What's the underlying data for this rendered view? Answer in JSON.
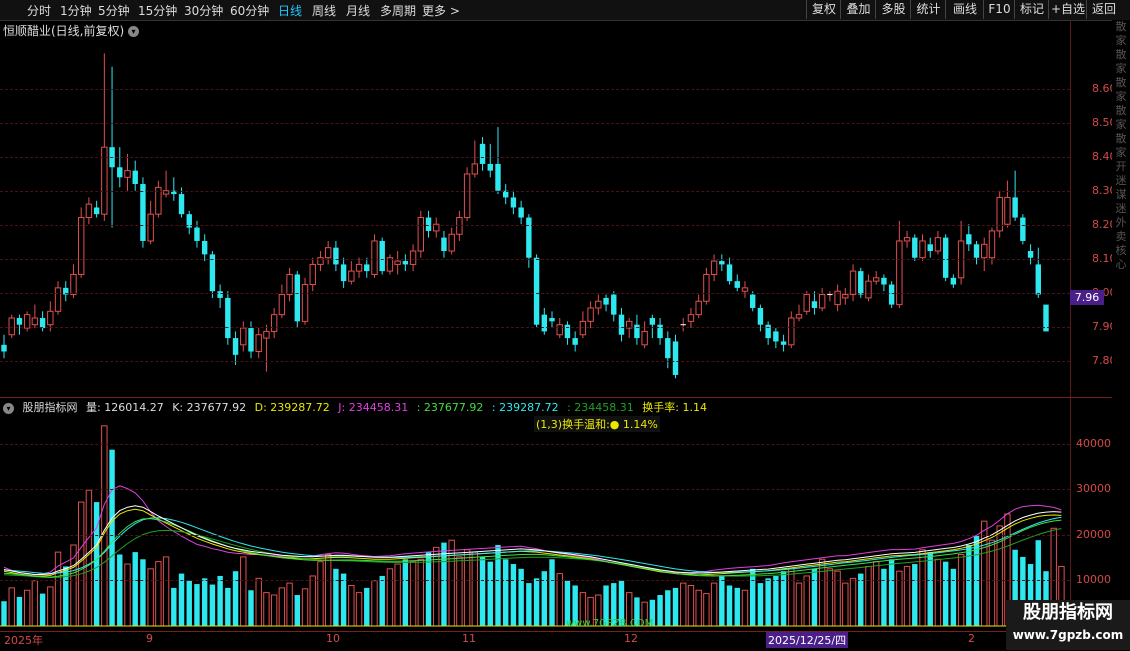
{
  "toolbar": {
    "periods": [
      "分时",
      "1分钟",
      "5分钟",
      "15分钟",
      "30分钟",
      "60分钟",
      "日线",
      "周线",
      "月线",
      "多周期",
      "更多 >"
    ],
    "active_period": "日线",
    "actions": [
      "复权",
      "叠加",
      "多股",
      "统计",
      "画线",
      "F10",
      "标记",
      "+自选",
      "返回"
    ]
  },
  "main": {
    "title": "恒顺醋业(日线,前复权)",
    "y_ticks": [
      "8.60",
      "8.50",
      "8.40",
      "8.30",
      "8.20",
      "8.10",
      "8.00",
      "7.90",
      "7.80"
    ],
    "last_price": "7.96"
  },
  "indicator": {
    "name": "股朋指标网",
    "vol": "量: 126014.27",
    "k": "K: 237677.92",
    "d": "D: 239287.72",
    "j": "J: 234458.31",
    "v1": ": 237677.92",
    "v2": ": 239287.72",
    "v3": ": 234458.31",
    "turnover": "换手率: 1.14",
    "note": "(1,3)换手温和:● 1.14%",
    "y_ticks": [
      "40000",
      "30000",
      "20000",
      "10000"
    ]
  },
  "xaxis": {
    "labels": [
      "2025年",
      "9",
      "10",
      "11",
      "12",
      "2"
    ],
    "cursor_date": "2025/12/25/四"
  },
  "watermark_url": "www.7GPZB.COM",
  "logo": {
    "title": "股朋指标网",
    "url": "www.7gpzb.com"
  },
  "right_strip": "散家散家散家散家散家开迷谋迷外卖核心",
  "colors": {
    "up": "#e05050",
    "down": "#2ee8f0",
    "grid": "#4a1212",
    "accent": "#1ec8ff"
  },
  "chart_data": [
    {
      "type": "candlestick",
      "title": "恒顺醋业(日线,前复权)",
      "ylim": [
        7.72,
        8.75
      ],
      "candles": [
        [
          7.84,
          7.82,
          7.87,
          7.8
        ],
        [
          7.87,
          7.92,
          7.93,
          7.86
        ],
        [
          7.92,
          7.9,
          7.93,
          7.87
        ],
        [
          7.89,
          7.93,
          7.94,
          7.88
        ],
        [
          7.9,
          7.92,
          7.96,
          7.89
        ],
        [
          7.92,
          7.89,
          7.94,
          7.88
        ],
        [
          7.9,
          7.94,
          7.97,
          7.88
        ],
        [
          7.94,
          8.01,
          8.03,
          7.93
        ],
        [
          8.01,
          7.99,
          8.03,
          7.97
        ],
        [
          7.99,
          8.05,
          8.08,
          7.98
        ],
        [
          8.05,
          8.22,
          8.25,
          8.04
        ],
        [
          8.22,
          8.26,
          8.28,
          8.2
        ],
        [
          8.25,
          8.23,
          8.27,
          8.22
        ],
        [
          8.23,
          8.43,
          8.71,
          8.21
        ],
        [
          8.43,
          8.37,
          8.67,
          8.19
        ],
        [
          8.37,
          8.34,
          8.43,
          8.31
        ],
        [
          8.34,
          8.36,
          8.41,
          8.3
        ],
        [
          8.36,
          8.32,
          8.39,
          8.3
        ],
        [
          8.32,
          8.15,
          8.34,
          8.13
        ],
        [
          8.15,
          8.23,
          8.27,
          8.14
        ],
        [
          8.23,
          8.31,
          8.33,
          8.22
        ],
        [
          8.29,
          8.3,
          8.36,
          8.28
        ],
        [
          8.3,
          8.29,
          8.34,
          8.27
        ],
        [
          8.29,
          8.23,
          8.31,
          8.22
        ],
        [
          8.23,
          8.19,
          8.24,
          8.17
        ],
        [
          8.19,
          8.15,
          8.21,
          8.13
        ],
        [
          8.15,
          8.11,
          8.17,
          8.09
        ],
        [
          8.11,
          8.0,
          8.12,
          7.98
        ],
        [
          8.0,
          7.98,
          8.02,
          7.95
        ],
        [
          7.98,
          7.86,
          8.0,
          7.84
        ],
        [
          7.86,
          7.81,
          7.88,
          7.78
        ],
        [
          7.84,
          7.89,
          7.91,
          7.82
        ],
        [
          7.89,
          7.82,
          7.91,
          7.8
        ],
        [
          7.82,
          7.87,
          7.89,
          7.8
        ],
        [
          7.86,
          7.88,
          7.9,
          7.76
        ],
        [
          7.88,
          7.93,
          7.95,
          7.86
        ],
        [
          7.93,
          7.99,
          8.02,
          7.92
        ],
        [
          7.99,
          8.05,
          8.07,
          7.97
        ],
        [
          8.05,
          7.91,
          8.06,
          7.89
        ],
        [
          7.91,
          8.02,
          8.04,
          7.9
        ],
        [
          8.02,
          8.08,
          8.1,
          8.0
        ],
        [
          8.08,
          8.1,
          8.12,
          8.06
        ],
        [
          8.1,
          8.13,
          8.15,
          8.08
        ],
        [
          8.13,
          8.08,
          8.15,
          8.06
        ],
        [
          8.08,
          8.03,
          8.1,
          8.01
        ],
        [
          8.03,
          8.06,
          8.09,
          8.02
        ],
        [
          8.06,
          8.08,
          8.1,
          8.04
        ],
        [
          8.08,
          8.06,
          8.1,
          8.04
        ],
        [
          8.05,
          8.15,
          8.17,
          8.04
        ],
        [
          8.15,
          8.06,
          8.16,
          8.05
        ],
        [
          8.06,
          8.1,
          8.11,
          8.05
        ],
        [
          8.08,
          8.09,
          8.12,
          8.05
        ],
        [
          8.09,
          8.08,
          8.11,
          8.06
        ],
        [
          8.08,
          8.12,
          8.14,
          8.06
        ],
        [
          8.12,
          8.22,
          8.24,
          8.1
        ],
        [
          8.22,
          8.18,
          8.24,
          8.16
        ],
        [
          8.18,
          8.2,
          8.22,
          8.16
        ],
        [
          8.16,
          8.12,
          8.18,
          8.1
        ],
        [
          8.12,
          8.17,
          8.19,
          8.11
        ],
        [
          8.17,
          8.22,
          8.24,
          8.15
        ],
        [
          8.22,
          8.35,
          8.37,
          8.21
        ],
        [
          8.35,
          8.38,
          8.45,
          8.34
        ],
        [
          8.44,
          8.38,
          8.46,
          8.36
        ],
        [
          8.38,
          8.36,
          8.44,
          8.34
        ],
        [
          8.38,
          8.3,
          8.49,
          8.29
        ],
        [
          8.3,
          8.28,
          8.32,
          8.26
        ],
        [
          8.28,
          8.25,
          8.3,
          8.23
        ],
        [
          8.25,
          8.22,
          8.27,
          8.2
        ],
        [
          8.22,
          8.1,
          8.23,
          8.07
        ],
        [
          8.1,
          7.9,
          8.11,
          7.89
        ],
        [
          7.93,
          7.88,
          7.95,
          7.87
        ],
        [
          7.92,
          7.91,
          7.94,
          7.89
        ],
        [
          7.87,
          7.9,
          7.92,
          7.86
        ],
        [
          7.9,
          7.86,
          7.91,
          7.84
        ],
        [
          7.86,
          7.84,
          7.88,
          7.82
        ],
        [
          7.87,
          7.91,
          7.94,
          7.86
        ],
        [
          7.91,
          7.95,
          7.97,
          7.89
        ],
        [
          7.95,
          7.97,
          7.99,
          7.93
        ],
        [
          7.98,
          7.96,
          7.99,
          7.94
        ],
        [
          7.99,
          7.93,
          8.0,
          7.91
        ],
        [
          7.93,
          7.87,
          7.95,
          7.85
        ],
        [
          7.89,
          7.91,
          7.92,
          7.86
        ],
        [
          7.9,
          7.86,
          7.93,
          7.84
        ],
        [
          7.84,
          7.88,
          7.91,
          7.83
        ],
        [
          7.92,
          7.9,
          7.93,
          7.86
        ],
        [
          7.9,
          7.86,
          7.92,
          7.84
        ],
        [
          7.86,
          7.8,
          7.88,
          7.77
        ],
        [
          7.85,
          7.75,
          7.87,
          7.74
        ],
        [
          7.9,
          7.9,
          7.92,
          7.88
        ],
        [
          7.91,
          7.93,
          7.95,
          7.89
        ],
        [
          7.93,
          7.97,
          7.99,
          7.92
        ],
        [
          7.97,
          8.05,
          8.07,
          7.96
        ],
        [
          8.05,
          8.09,
          8.11,
          8.03
        ],
        [
          8.09,
          8.08,
          8.11,
          8.06
        ],
        [
          8.08,
          8.03,
          8.1,
          8.02
        ],
        [
          8.03,
          8.01,
          8.05,
          8.0
        ],
        [
          8.0,
          8.01,
          8.03,
          7.98
        ],
        [
          7.99,
          7.95,
          8.0,
          7.94
        ],
        [
          7.95,
          7.9,
          7.96,
          7.88
        ],
        [
          7.9,
          7.86,
          7.91,
          7.84
        ],
        [
          7.88,
          7.85,
          7.89,
          7.83
        ],
        [
          7.85,
          7.84,
          7.87,
          7.82
        ],
        [
          7.84,
          7.92,
          7.94,
          7.83
        ],
        [
          7.92,
          7.93,
          7.96,
          7.91
        ],
        [
          7.94,
          7.99,
          8.0,
          7.93
        ],
        [
          7.97,
          7.95,
          8.0,
          7.93
        ],
        [
          7.95,
          7.99,
          8.01,
          7.94
        ],
        [
          7.99,
          7.99,
          8.0,
          7.97
        ],
        [
          7.96,
          8.0,
          8.02,
          7.94
        ],
        [
          7.98,
          7.99,
          8.01,
          7.96
        ],
        [
          7.99,
          8.06,
          8.08,
          7.97
        ],
        [
          8.06,
          7.99,
          8.07,
          7.98
        ],
        [
          7.98,
          8.03,
          8.05,
          7.97
        ],
        [
          8.03,
          8.04,
          8.06,
          8.02
        ],
        [
          8.04,
          8.02,
          8.05,
          8.0
        ],
        [
          8.02,
          7.96,
          8.03,
          7.95
        ],
        [
          7.96,
          8.15,
          8.21,
          7.95
        ],
        [
          8.15,
          8.16,
          8.18,
          8.13
        ],
        [
          8.16,
          8.1,
          8.17,
          8.09
        ],
        [
          8.1,
          8.15,
          8.17,
          8.09
        ],
        [
          8.14,
          8.12,
          8.16,
          8.1
        ],
        [
          8.12,
          8.16,
          8.18,
          8.11
        ],
        [
          8.16,
          8.04,
          8.17,
          8.03
        ],
        [
          8.04,
          8.02,
          8.05,
          8.01
        ],
        [
          8.04,
          8.15,
          8.21,
          8.02
        ],
        [
          8.17,
          8.14,
          8.2,
          8.12
        ],
        [
          8.14,
          8.1,
          8.15,
          8.08
        ],
        [
          8.1,
          8.14,
          8.16,
          8.06
        ],
        [
          8.1,
          8.18,
          8.19,
          8.08
        ],
        [
          8.18,
          8.28,
          8.3,
          8.16
        ],
        [
          8.2,
          8.28,
          8.33,
          8.19
        ],
        [
          8.28,
          8.22,
          8.36,
          8.21
        ],
        [
          8.22,
          8.15,
          8.23,
          8.14
        ],
        [
          8.12,
          8.1,
          8.14,
          8.08
        ],
        [
          8.08,
          7.99,
          8.13,
          7.98
        ],
        [
          7.96,
          7.88,
          7.97,
          7.97
        ]
      ]
    },
    {
      "type": "bar+line",
      "title": "股朋指标网",
      "ylim": [
        0,
        47000
      ],
      "volumes": [
        5200,
        8000,
        6100,
        7500,
        9500,
        6800,
        8200,
        15500,
        12500,
        17000,
        26000,
        28500,
        26000,
        42000,
        37000,
        15000,
        13000,
        15500,
        14000,
        12000,
        13500,
        14500,
        8000,
        11000,
        9500,
        8800,
        10000,
        8700,
        10500,
        8000,
        11500,
        14500,
        7500,
        10000,
        7000,
        6500,
        8000,
        9000,
        6500,
        7800,
        10500,
        13500,
        15000,
        12000,
        11000,
        8500,
        7000,
        8000,
        9500,
        10500,
        12000,
        13000,
        14000,
        13500,
        14000,
        15500,
        16500,
        17500,
        18000,
        14500,
        16000,
        15500,
        14500,
        13500,
        17000,
        14000,
        13000,
        12000,
        9000,
        10000,
        11500,
        14000,
        11000,
        9500,
        8500,
        7000,
        6000,
        6500,
        8500,
        9000,
        9500,
        7000,
        6000,
        5000,
        5500,
        6500,
        7500,
        8000,
        9000,
        8500,
        7500,
        6800,
        9000,
        10500,
        8500,
        8000,
        7500,
        12000,
        9000,
        10000,
        10500,
        11500,
        12000,
        9000,
        10500,
        12000,
        14000,
        12000,
        11500,
        9000,
        10000,
        11000,
        12500,
        13500,
        12000,
        14000,
        11500,
        12500,
        13000,
        16000,
        15500,
        14000,
        13500,
        12000,
        15000,
        17000,
        19000,
        22000,
        18000,
        21000,
        23500,
        16000,
        14500,
        13000,
        18000,
        11500,
        20500,
        12500
      ],
      "lines": {
        "K": [
          11500,
          11200,
          10900,
          10700,
          10500,
          10500,
          10600,
          11200,
          11700,
          12300,
          13600,
          15000,
          16500,
          19500,
          22000,
          23500,
          24200,
          24500,
          24200,
          23300,
          22400,
          21600,
          20800,
          20000,
          19200,
          18400,
          17800,
          17200,
          16700,
          16200,
          15800,
          15500,
          15200,
          15000,
          14800,
          14600,
          14400,
          14300,
          14200,
          14100,
          14100,
          14200,
          14300,
          14400,
          14400,
          14300,
          14200,
          14100,
          14000,
          14000,
          14000,
          14100,
          14200,
          14300,
          14400,
          14500,
          14600,
          14700,
          14800,
          14900,
          15000,
          15100,
          15200,
          15300,
          15400,
          15500,
          15600,
          15700,
          15600,
          15500,
          15300,
          15100,
          14900,
          14700,
          14500,
          14300,
          14100,
          13800,
          13500,
          13200,
          12900,
          12600,
          12300,
          12000,
          11700,
          11400,
          11200,
          11000,
          10900,
          10800,
          10800,
          10800,
          10900,
          11000,
          11100,
          11200,
          11300,
          11400,
          11500,
          11600,
          11800,
          12000,
          12200,
          12400,
          12600,
          12800,
          13000,
          13200,
          13400,
          13500,
          13700,
          13900,
          14100,
          14300,
          14500,
          14700,
          14800,
          14900,
          15000,
          15200,
          15400,
          15600,
          15800,
          16000,
          16300,
          16700,
          17200,
          17900,
          18600,
          19500,
          20500,
          21400,
          22100,
          22600,
          23000,
          23200,
          23300,
          23200
        ]
      }
    }
  ]
}
